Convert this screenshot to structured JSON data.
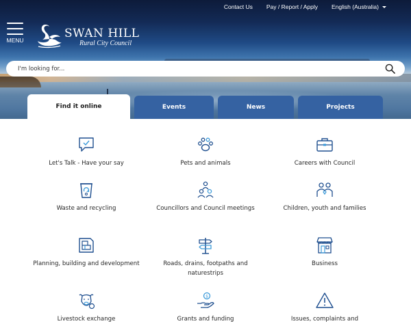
{
  "header": {
    "top_links": [
      "Contact Us",
      "Pay / Report / Apply",
      "English (Australia)"
    ],
    "menu_label": "MENU",
    "logo_title": "SWAN HILL",
    "logo_subtitle": "Rural City Council"
  },
  "search": {
    "placeholder": "I'm looking for..."
  },
  "tabs": [
    "Find it online",
    "Events",
    "News",
    "Projects"
  ],
  "colors": {
    "tab_blue": "#3562a2",
    "icon_blue": "#1f4f8f"
  },
  "items": [
    {
      "label": "Let's Talk - Have your say",
      "icon": "chat-check-icon"
    },
    {
      "label": "Pets and animals",
      "icon": "paw-icon"
    },
    {
      "label": "Careers with Council",
      "icon": "briefcase-icon"
    },
    {
      "label": "Waste and recycling",
      "icon": "recycle-bin-icon"
    },
    {
      "label": "Councillors and Council meetings",
      "icon": "councillors-icon"
    },
    {
      "label": "Children, youth and families",
      "icon": "family-icon"
    },
    {
      "label": "Planning, building and development",
      "icon": "floor-plan-icon"
    },
    {
      "label": "Roads, drains, footpaths and naturestrips",
      "icon": "signpost-icon"
    },
    {
      "label": "Business",
      "icon": "shopfront-icon"
    },
    {
      "label": "Livestock exchange",
      "icon": "livestock-icon"
    },
    {
      "label": "Grants and funding",
      "icon": "grant-hand-icon"
    },
    {
      "label": "Issues, complaints and",
      "icon": "warning-icon"
    }
  ]
}
